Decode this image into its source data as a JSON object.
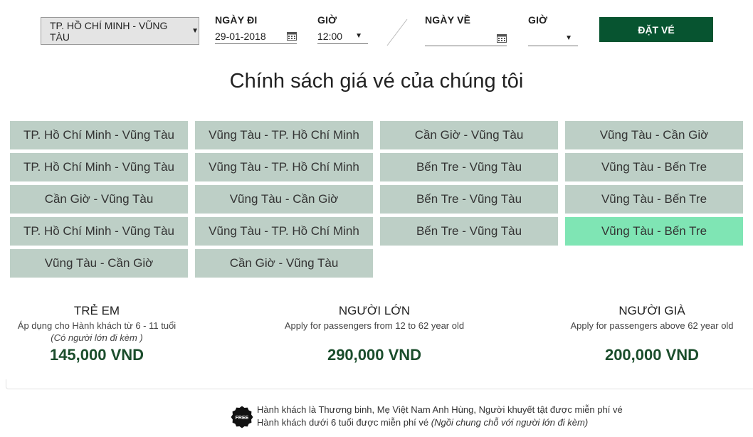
{
  "booking": {
    "route": "TP. HỒ CHÍ MINH - VŨNG TÀU",
    "depart_label": "NGÀY ĐI",
    "depart_date": "29-01-2018",
    "depart_time_label": "GIỜ",
    "depart_time": "12:00",
    "return_label": "NGÀY VỀ",
    "return_date": "",
    "return_time_label": "GIỜ",
    "return_time": "",
    "book_button": "ĐẶT VÉ"
  },
  "title": "Chính sách giá vé của chúng tôi",
  "routes": [
    "TP. Hồ Chí Minh - Vũng Tàu",
    "Vũng Tàu - TP. Hồ Chí Minh",
    "Cần Giờ - Vũng Tàu",
    "Vũng Tàu - Cần Giờ",
    "TP. Hồ Chí Minh - Vũng Tàu",
    "Vũng Tàu - TP. Hồ Chí Minh",
    "Bến Tre - Vũng Tàu",
    "Vũng Tàu - Bến Tre",
    "Cần Giờ - Vũng Tàu",
    "Vũng Tàu - Cần Giờ",
    "Bến Tre - Vũng Tàu",
    "Vũng Tàu - Bến Tre",
    "TP. Hồ Chí Minh - Vũng Tàu",
    "Vũng Tàu - TP. Hồ Chí Minh",
    "Bến Tre - Vũng Tàu",
    "Vũng Tàu - Bến Tre",
    "Vũng Tàu - Cần Giờ",
    "Cần Giờ - Vũng Tàu"
  ],
  "active_route_index": 15,
  "colors": {
    "route_bg": "#bdcfc6",
    "route_active_bg": "#7fe5b4",
    "accent": "#075430",
    "price": "#1b4d2c"
  },
  "prices": {
    "child": {
      "name": "TRẺ EM",
      "desc": "Áp dụng cho Hành khách từ 6 - 11 tuổi",
      "note": "(Có người lớn đi kèm )",
      "price": "145,000 VND"
    },
    "adult": {
      "name": "NGƯỜI LỚN",
      "desc": "Apply for passengers from 12 to 62 year old",
      "price": "290,000 VND"
    },
    "senior": {
      "name": "NGƯỜI GIÀ",
      "desc": "Apply for passengers above 62 year old",
      "price": "200,000 VND"
    }
  },
  "free": {
    "badge": "FREE",
    "line1": "Hành khách là Thương binh, Mẹ Việt Nam Anh Hùng, Người khuyết tật được miễn phí vé",
    "line2": "Hành khách dưới 6 tuổi được miễn phí vé",
    "line2_note": "(Ngồi chung chỗ với người lớn đi kèm)"
  }
}
